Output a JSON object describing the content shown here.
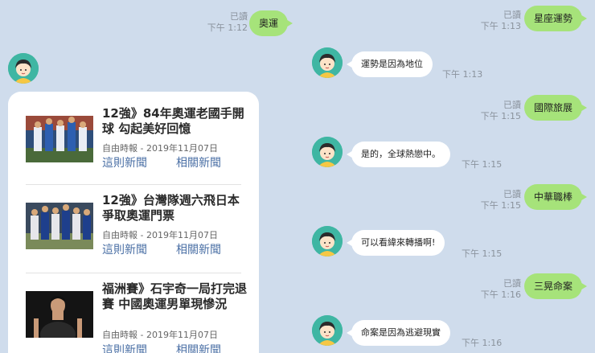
{
  "left": {
    "status": {
      "read": "已讀",
      "time": "下午 1:12"
    },
    "sent_message": "奧運",
    "news": [
      {
        "title": "12強》84年奧運老國手開球 勾起美好回憶",
        "source": "自由時報 - 2019年11月07日",
        "link_story": "這則新聞",
        "link_related": "相關新聞"
      },
      {
        "title": "12強》台灣隊週六飛日本 爭取奧運門票",
        "source": "自由時報 - 2019年11月07日",
        "link_story": "這則新聞",
        "link_related": "相關新聞"
      },
      {
        "title": "福洲賽》石宇奇一局打完退賽 中國奧運男單現慘況",
        "source": "自由時報 - 2019年11月07日",
        "link_story": "這則新聞",
        "link_related": "相關新聞"
      }
    ]
  },
  "right": {
    "messages": [
      {
        "type": "out",
        "text": "星座運勢",
        "read": "已讀",
        "time": "下午 1:13"
      },
      {
        "type": "in",
        "text": "運勢是因為地位",
        "time": "下午 1:13"
      },
      {
        "type": "out",
        "text": "國際旅展",
        "read": "已讀",
        "time": "下午 1:15"
      },
      {
        "type": "in",
        "text": "是的，全球熱戀中。",
        "time": "下午 1:15"
      },
      {
        "type": "out",
        "text": "中華職棒",
        "read": "已讀",
        "time": "下午 1:15"
      },
      {
        "type": "in",
        "text": "可以看緯來轉播啊!",
        "time": "下午 1:15"
      },
      {
        "type": "out",
        "text": "三晃命案",
        "read": "已讀",
        "time": "下午 1:16"
      },
      {
        "type": "in",
        "text": "命案是因為逃避現實",
        "time": "下午 1:16"
      }
    ]
  },
  "colors": {
    "background": "#cfdcec",
    "outgoing_bubble": "#a6e37a",
    "incoming_bubble": "#ffffff",
    "link": "#4a6fa5",
    "avatar": "#3fb6a3"
  },
  "icons": {
    "bot_avatar": "cartoon-girl-avatar-icon"
  }
}
